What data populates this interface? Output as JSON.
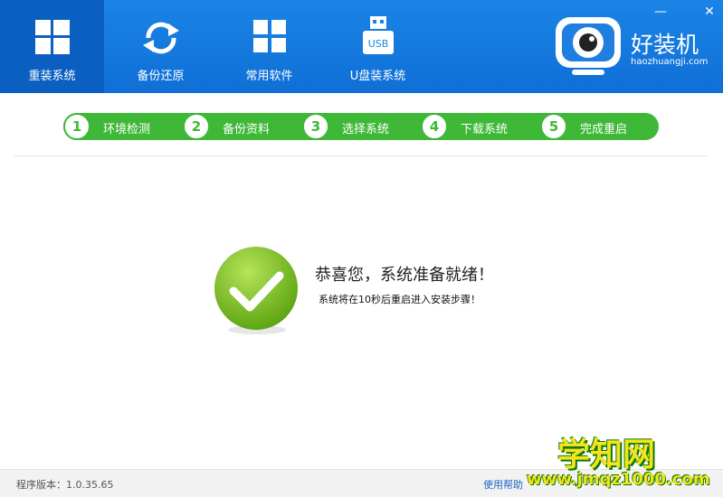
{
  "nav": {
    "items": [
      {
        "label": "重装系统",
        "icon": "windows-icon"
      },
      {
        "label": "备份还原",
        "icon": "sync-icon"
      },
      {
        "label": "常用软件",
        "icon": "apps-grid-icon"
      },
      {
        "label": "U盘装系统",
        "icon": "usb-icon"
      }
    ],
    "active": 0,
    "usb_text": "USB"
  },
  "window": {
    "minimize": "—",
    "close": "✕"
  },
  "brand": {
    "name": "好装机",
    "url": "haozhuangji.com"
  },
  "steps": [
    {
      "num": "1",
      "label": "环境检测"
    },
    {
      "num": "2",
      "label": "备份资料"
    },
    {
      "num": "3",
      "label": "选择系统"
    },
    {
      "num": "4",
      "label": "下载系统"
    },
    {
      "num": "5",
      "label": "完成重启"
    }
  ],
  "message": {
    "title": "恭喜您，系统准备就绪！",
    "subtitle": "系统将在10秒后重启进入安装步骤！"
  },
  "footer": {
    "version": "程序版本：1.0.35.65",
    "help": "使用帮助"
  },
  "watermark": {
    "big": "学知网",
    "small": "www.jmqz1000.com"
  },
  "colors": {
    "top_blue": "#1a84e6",
    "active_blue": "#0a5fc0",
    "step_green": "#3fb838",
    "check_green": "#7cc520"
  }
}
